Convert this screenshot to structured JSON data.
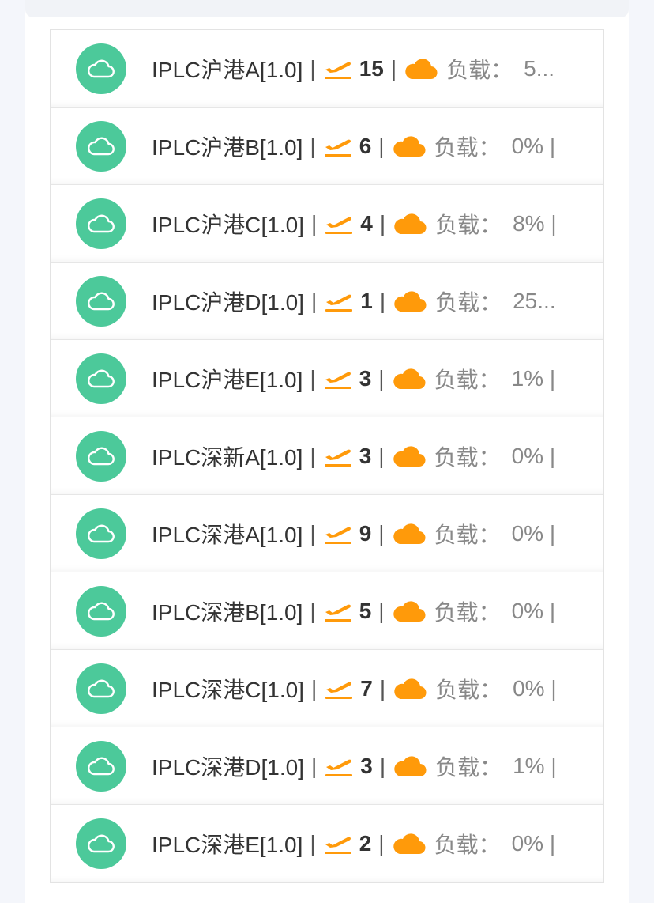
{
  "colors": {
    "status_online": "#4cc99a",
    "accent_orange": "#ff9a0a",
    "text_dark": "#333333",
    "text_muted": "#888888"
  },
  "icons": {
    "status": "cloud-icon",
    "online_users": "plane-takeoff-icon",
    "load": "cloud-filled-icon"
  },
  "separator": "|",
  "nodes": [
    {
      "name": "IPLC沪港A[1.0]",
      "users": "15",
      "load_label": "负载：",
      "load_value": "5..."
    },
    {
      "name": "IPLC沪港B[1.0]",
      "users": "6",
      "load_label": "负载：",
      "load_value": "0% |"
    },
    {
      "name": "IPLC沪港C[1.0]",
      "users": "4",
      "load_label": "负载：",
      "load_value": "8% |"
    },
    {
      "name": "IPLC沪港D[1.0]",
      "users": "1",
      "load_label": "负载：",
      "load_value": "25..."
    },
    {
      "name": "IPLC沪港E[1.0]",
      "users": "3",
      "load_label": "负载：",
      "load_value": "1% |"
    },
    {
      "name": "IPLC深新A[1.0]",
      "users": "3",
      "load_label": "负载：",
      "load_value": "0% |"
    },
    {
      "name": "IPLC深港A[1.0]",
      "users": "9",
      "load_label": "负载：",
      "load_value": "0% |"
    },
    {
      "name": "IPLC深港B[1.0]",
      "users": "5",
      "load_label": "负载：",
      "load_value": "0% |"
    },
    {
      "name": "IPLC深港C[1.0]",
      "users": "7",
      "load_label": "负载：",
      "load_value": "0% |"
    },
    {
      "name": "IPLC深港D[1.0]",
      "users": "3",
      "load_label": "负载：",
      "load_value": "1% |"
    },
    {
      "name": "IPLC深港E[1.0]",
      "users": "2",
      "load_label": "负载：",
      "load_value": "0% |"
    }
  ]
}
